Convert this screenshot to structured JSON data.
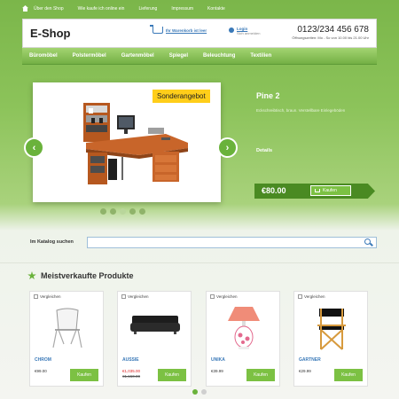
{
  "topnav": {
    "items": [
      "Über den Shop",
      "Wie kaufe ich online ein",
      "Lieferung",
      "Impressum",
      "Kontakte"
    ]
  },
  "header": {
    "logo": "E-Shop",
    "cart_label": "Ihr Warenkorb ist leer",
    "login_label": "Login",
    "register_label": "Sich anmelden",
    "phone": "0123/234 456 678",
    "hours": "Öffnungszeiten: Mo - So von 10.00 bis 21.00 Uhr"
  },
  "categories": [
    "Büromöbel",
    "Polstermöbel",
    "Gartenmöbel",
    "Spiegel",
    "Beleuchtung",
    "Textilien"
  ],
  "slider": {
    "badge": "Sonderangebot",
    "title": "Pine 2",
    "description": "Eckschreibtisch, braun. Verstellbare Einlegeböden",
    "details_label": "Details",
    "price": "€80.00",
    "cart_button": "Kaufen",
    "dots_total": 5,
    "dots_active": 2
  },
  "search": {
    "label": "Im Katalog suchen",
    "placeholder": ""
  },
  "bestsellers": {
    "title": "Meistverkaufte Produkte",
    "compare_label": "Vergleichen",
    "buy_label": "Kaufen",
    "items": [
      {
        "name": "CHROM",
        "price": "€99.00",
        "old_price": ""
      },
      {
        "name": "AUSSIE",
        "price": "€1,035.00",
        "old_price": "€1,150.00"
      },
      {
        "name": "UNIKA",
        "price": "€39.99",
        "old_price": ""
      },
      {
        "name": "GARTNER",
        "price": "€29.99",
        "old_price": ""
      }
    ]
  },
  "colors": {
    "accent_green": "#6ab23b",
    "link_blue": "#3a79b8",
    "badge_yellow": "#ffce1a",
    "sale_red": "#dd2222"
  }
}
